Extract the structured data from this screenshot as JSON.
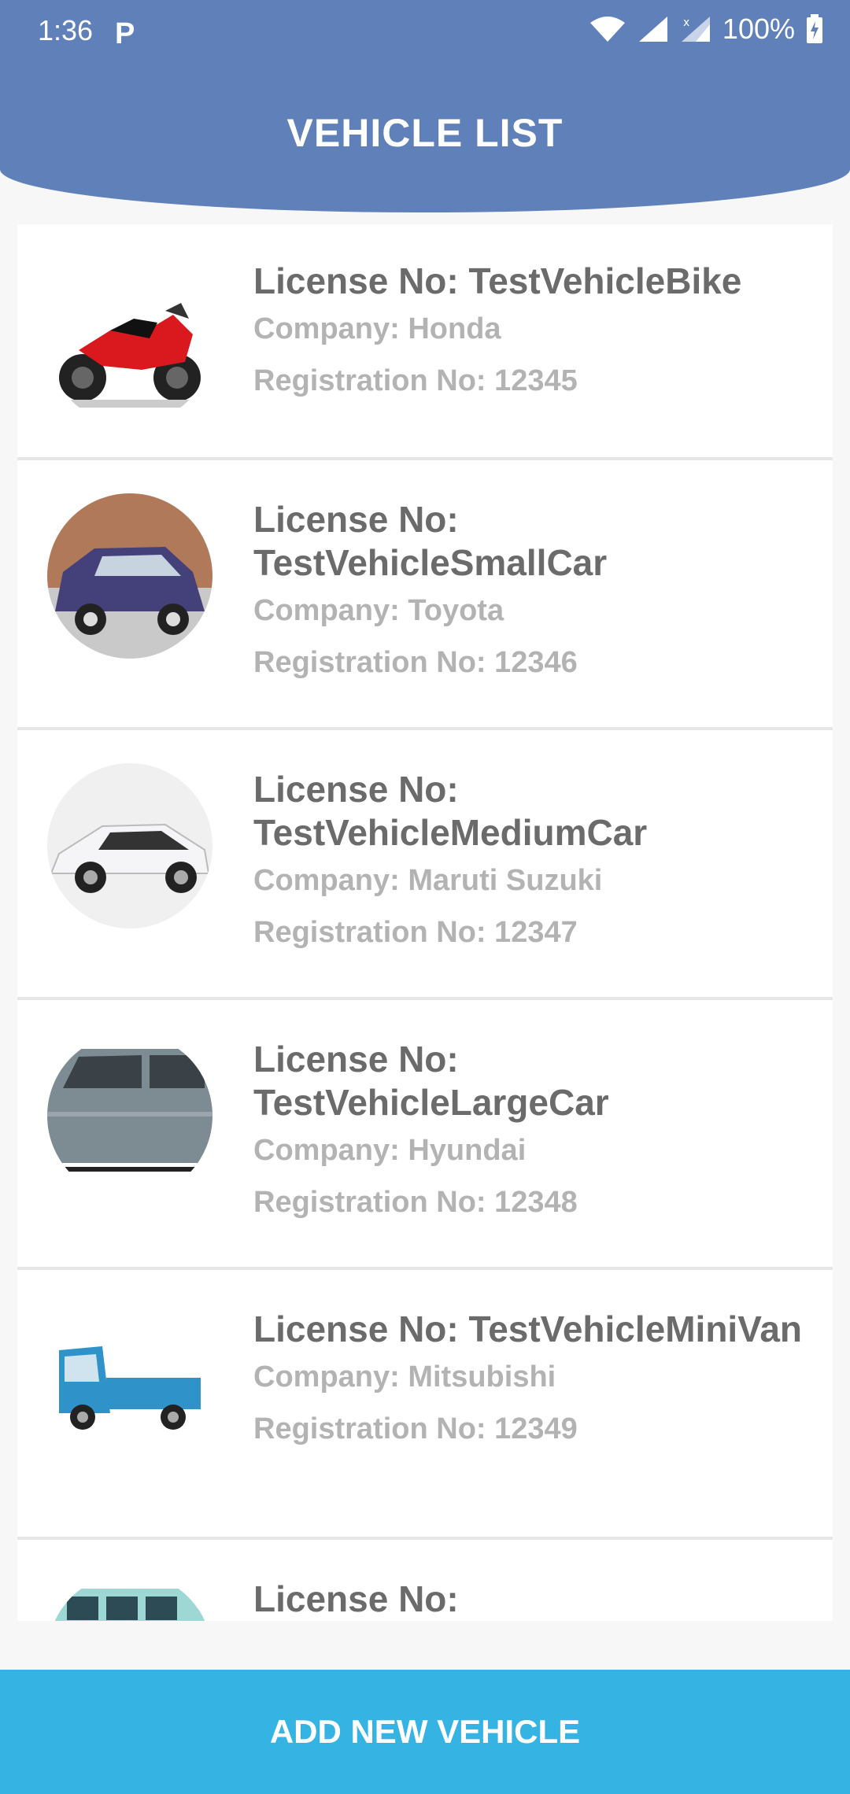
{
  "status_bar": {
    "time": "1:36",
    "notification_icon": "parking-icon",
    "battery": "100%"
  },
  "header": {
    "title": "VEHICLE LIST",
    "background_color": "#5f80b8"
  },
  "vehicles": [
    {
      "license": "License No: TestVehicleBike",
      "company": "Company: Honda",
      "registration": "Registration No: 12345",
      "image": "motorcycle-image"
    },
    {
      "license": "License No: TestVehicleSmallCar",
      "company": "Company: Toyota",
      "registration": "Registration No: 12346",
      "image": "small-car-image"
    },
    {
      "license": "License No: TestVehicleMediumCar",
      "company": "Company: Maruti Suzuki",
      "registration": "Registration No: 12347",
      "image": "medium-car-image"
    },
    {
      "license": "License No: TestVehicleLargeCar",
      "company": "Company: Hyundai",
      "registration": "Registration No: 12348",
      "image": "large-car-image"
    },
    {
      "license": "License No: TestVehicleMiniVan",
      "company": "Company: Mitsubishi",
      "registration": "Registration No: 12349",
      "image": "mini-truck-image"
    },
    {
      "license": "License No:",
      "image": "van-image"
    }
  ],
  "footer": {
    "add_button_label": "ADD NEW VEHICLE",
    "button_color": "#35b4e4"
  }
}
